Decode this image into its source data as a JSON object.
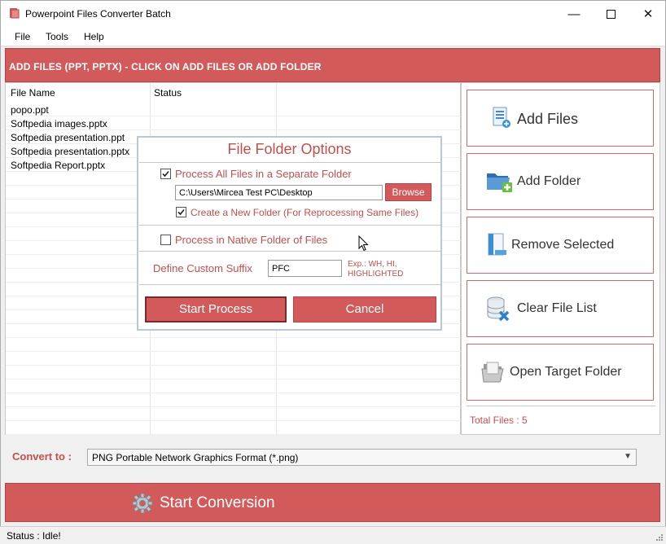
{
  "window": {
    "title": "Powerpoint Files Converter Batch"
  },
  "menu": [
    "File",
    "Tools",
    "Help"
  ],
  "header": {
    "text": "ADD FILES (PPT, PPTX) - CLICK ON ADD FILES OR ADD FOLDER"
  },
  "filelist": {
    "columns": [
      "File Name",
      "Status"
    ],
    "rows": [
      {
        "name": "popo.ppt",
        "status": ""
      },
      {
        "name": "Softpedia images.pptx",
        "status": ""
      },
      {
        "name": "Softpedia presentation.ppt",
        "status": ""
      },
      {
        "name": "Softpedia presentation.pptx",
        "status": ""
      },
      {
        "name": "Softpedia Report.pptx",
        "status": ""
      }
    ]
  },
  "sidebar": {
    "add_files": "Add Files",
    "add_folder": "Add Folder",
    "remove_selected": "Remove Selected",
    "clear_list": "Clear File List",
    "open_target": "Open Target Folder",
    "total": "Total Files : 5"
  },
  "convert": {
    "label": "Convert to :",
    "selected": "PNG Portable Network Graphics Format (*.png)"
  },
  "start_conversion": "Start Conversion",
  "status": "Status  :  Idle!",
  "dialog": {
    "title": "File Folder Options",
    "separate_folder": {
      "label": "Process All Files in a Separate Folder",
      "checked": true
    },
    "path": "C:\\Users\\Mircea Test PC\\Desktop",
    "browse": "Browse",
    "new_folder": {
      "label": "Create a New Folder (For Reprocessing Same Files)",
      "checked": true
    },
    "native_folder": {
      "label": "Process in Native Folder of Files",
      "checked": false
    },
    "suffix_label": "Define Custom Suffix",
    "suffix_value": "PFC",
    "suffix_hint_1": "Exp.: WH, HI,",
    "suffix_hint_2": "HIGHLIGHTED",
    "start_button": "Start Process",
    "cancel_button": "Cancel"
  },
  "colors": {
    "accent": "#d35a5b",
    "accent_text": "#c0504d"
  }
}
